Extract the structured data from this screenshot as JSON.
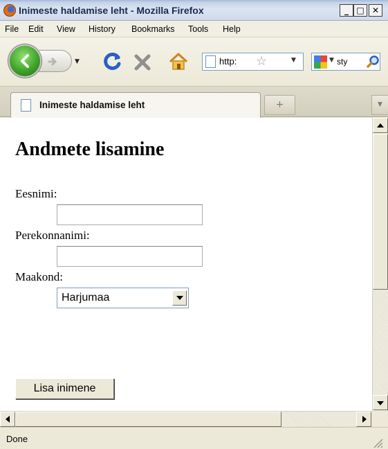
{
  "window": {
    "title": "Inimeste haldamise leht - Mozilla Firefox",
    "minimize_label": "_",
    "maximize_label": "□",
    "close_label": "✕"
  },
  "menu": [
    {
      "label": "File"
    },
    {
      "label": "Edit"
    },
    {
      "label": "View"
    },
    {
      "label": "History"
    },
    {
      "label": "Bookmarks"
    },
    {
      "label": "Tools"
    },
    {
      "label": "Help"
    }
  ],
  "navbar": {
    "url": "http:",
    "search_text": "sty"
  },
  "tabs": {
    "active_label": "Inimeste haldamise leht",
    "new_tab_label": "+"
  },
  "page": {
    "heading": "Andmete lisamine",
    "first_name_label": "Eesnimi:",
    "first_name_value": "",
    "last_name_label": "Perekonnanimi:",
    "last_name_value": "",
    "county_label": "Maakond:",
    "county_selected": "Harjumaa",
    "submit_label": "Lisa inimene"
  },
  "status": {
    "text": "Done"
  },
  "icons": {
    "back": "back-arrow-icon",
    "forward": "forward-arrow-icon",
    "reload": "reload-icon",
    "stop": "stop-icon",
    "home": "home-icon",
    "bookmark": "star-icon",
    "search": "magnifier-icon"
  },
  "colors": {
    "chrome": "#ece9d8",
    "title_text": "#1a2a4d",
    "back_button": "#3fa42a",
    "reload": "#2a5fc4",
    "stop": "#8f8f8f",
    "home": "#e0a21c"
  }
}
